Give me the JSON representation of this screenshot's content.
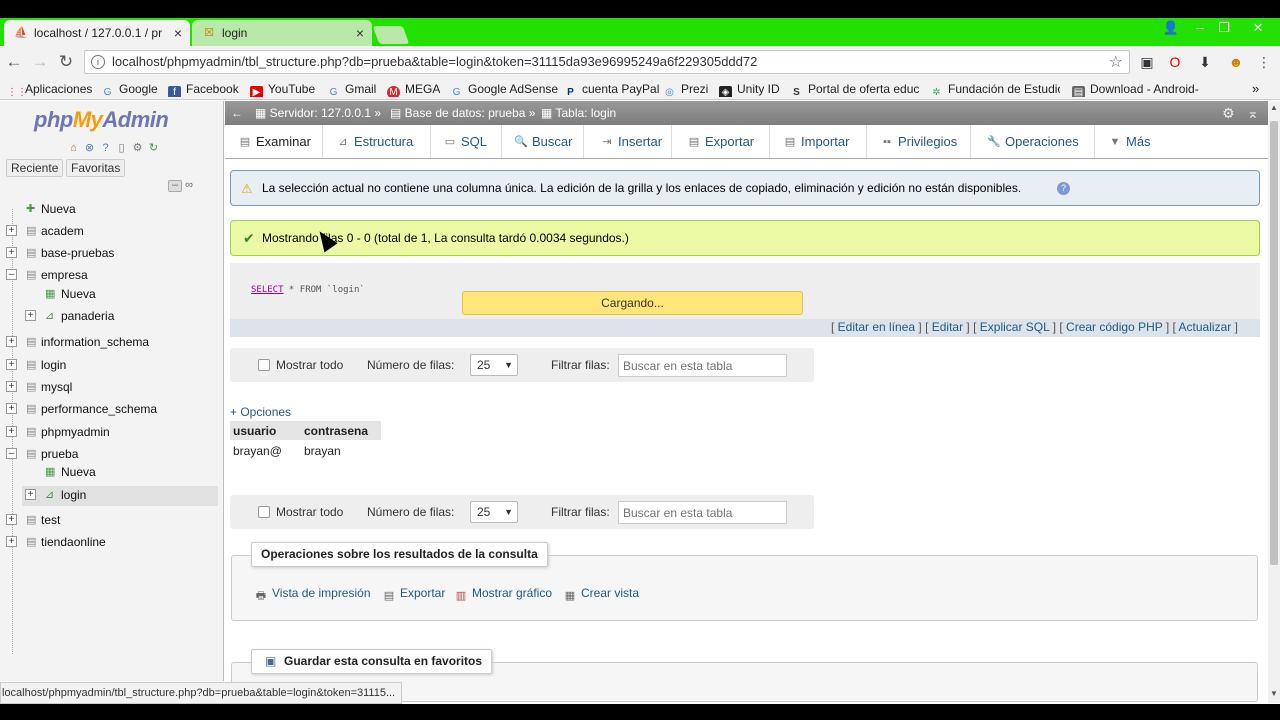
{
  "browser": {
    "tabs": [
      {
        "label": "localhost / 127.0.0.1 / pr",
        "active": true
      },
      {
        "label": "login",
        "active": false
      }
    ],
    "url": "localhost/phpmyadmin/tbl_structure.php?db=prueba&table=login&token=31115da93e96995249a6f229305ddd72",
    "bookmarks": [
      "Aplicaciones",
      "Google",
      "Facebook",
      "YouTube",
      "Gmail",
      "MEGA",
      "Google AdSense",
      "cuenta PayPal",
      "Prezi",
      "Unity ID",
      "Portal de oferta educ",
      "Fundación de Estudio",
      "Download - Android-"
    ],
    "more_bookmarks": "»",
    "status_url": "localhost/phpmyadmin/tbl_structure.php?db=prueba&table=login&token=31115..."
  },
  "nav": {
    "logo": {
      "php": "php",
      "my": "My",
      "admin": "Admin"
    },
    "buttons": {
      "recent": "Reciente",
      "favorites": "Favoritas"
    },
    "tree": [
      {
        "label": "Nueva",
        "level": 0,
        "type": "new"
      },
      {
        "label": "academ",
        "level": 0,
        "type": "db"
      },
      {
        "label": "base-pruebas",
        "level": 0,
        "type": "db"
      },
      {
        "label": "empresa",
        "level": 0,
        "type": "db-open"
      },
      {
        "label": "Nueva",
        "level": 1,
        "type": "new"
      },
      {
        "label": "panaderia",
        "level": 1,
        "type": "table"
      },
      {
        "label": "information_schema",
        "level": 0,
        "type": "db"
      },
      {
        "label": "login",
        "level": 0,
        "type": "db"
      },
      {
        "label": "mysql",
        "level": 0,
        "type": "db"
      },
      {
        "label": "performance_schema",
        "level": 0,
        "type": "db"
      },
      {
        "label": "phpmyadmin",
        "level": 0,
        "type": "db"
      },
      {
        "label": "prueba",
        "level": 0,
        "type": "db-open"
      },
      {
        "label": "Nueva",
        "level": 1,
        "type": "new"
      },
      {
        "label": "login",
        "level": 1,
        "type": "table",
        "selected": true
      },
      {
        "label": "test",
        "level": 0,
        "type": "db"
      },
      {
        "label": "tiendaonline",
        "level": 0,
        "type": "db"
      }
    ]
  },
  "breadcrumb": {
    "server": "Servidor: 127.0.0.1 »",
    "database": "Base de datos: prueba »",
    "table": "Tabla: login"
  },
  "tabs": [
    {
      "label": "Examinar",
      "icon": "browse-icon"
    },
    {
      "label": "Estructura",
      "icon": "structure-icon"
    },
    {
      "label": "SQL",
      "icon": "sql-icon"
    },
    {
      "label": "Buscar",
      "icon": "search-icon"
    },
    {
      "label": "Insertar",
      "icon": "insert-icon"
    },
    {
      "label": "Exportar",
      "icon": "export-icon"
    },
    {
      "label": "Importar",
      "icon": "import-icon"
    },
    {
      "label": "Privilegios",
      "icon": "privileges-icon"
    },
    {
      "label": "Operaciones",
      "icon": "wrench-icon"
    },
    {
      "label": "Más",
      "icon": "more-caret-icon"
    }
  ],
  "notice": "La selección actual no contiene una columna única. La edición de la grilla y los enlaces de copiado, eliminación y edición no están disponibles.",
  "success": "Mostrando filas 0 - 0 (total de 1, La consulta tardó 0.0034 segundos.)",
  "sql": {
    "keyword": "SELECT",
    "rest": " * FROM `login`"
  },
  "loading": "Cargando...",
  "sql_links": [
    "Editar en línea",
    "Editar",
    "Explicar SQL",
    "Crear código PHP",
    "Actualizar"
  ],
  "navigation_row": {
    "show_all": "Mostrar todo",
    "rows_label": "Número de filas:",
    "rows_value": "25",
    "filter_label": "Filtrar filas:",
    "filter_placeholder": "Buscar en esta tabla"
  },
  "options": "+ Opciones",
  "table": {
    "headers": [
      "usuario",
      "contrasena"
    ],
    "rows": [
      [
        "brayan@",
        "brayan"
      ]
    ]
  },
  "query_ops": {
    "legend": "Operaciones sobre los resultados de la consulta",
    "links": [
      "Vista de impresión",
      "Exportar",
      "Mostrar gráfico",
      "Crear vista"
    ]
  },
  "bookmark_query": {
    "legend": "Guardar esta consulta en favoritos"
  }
}
